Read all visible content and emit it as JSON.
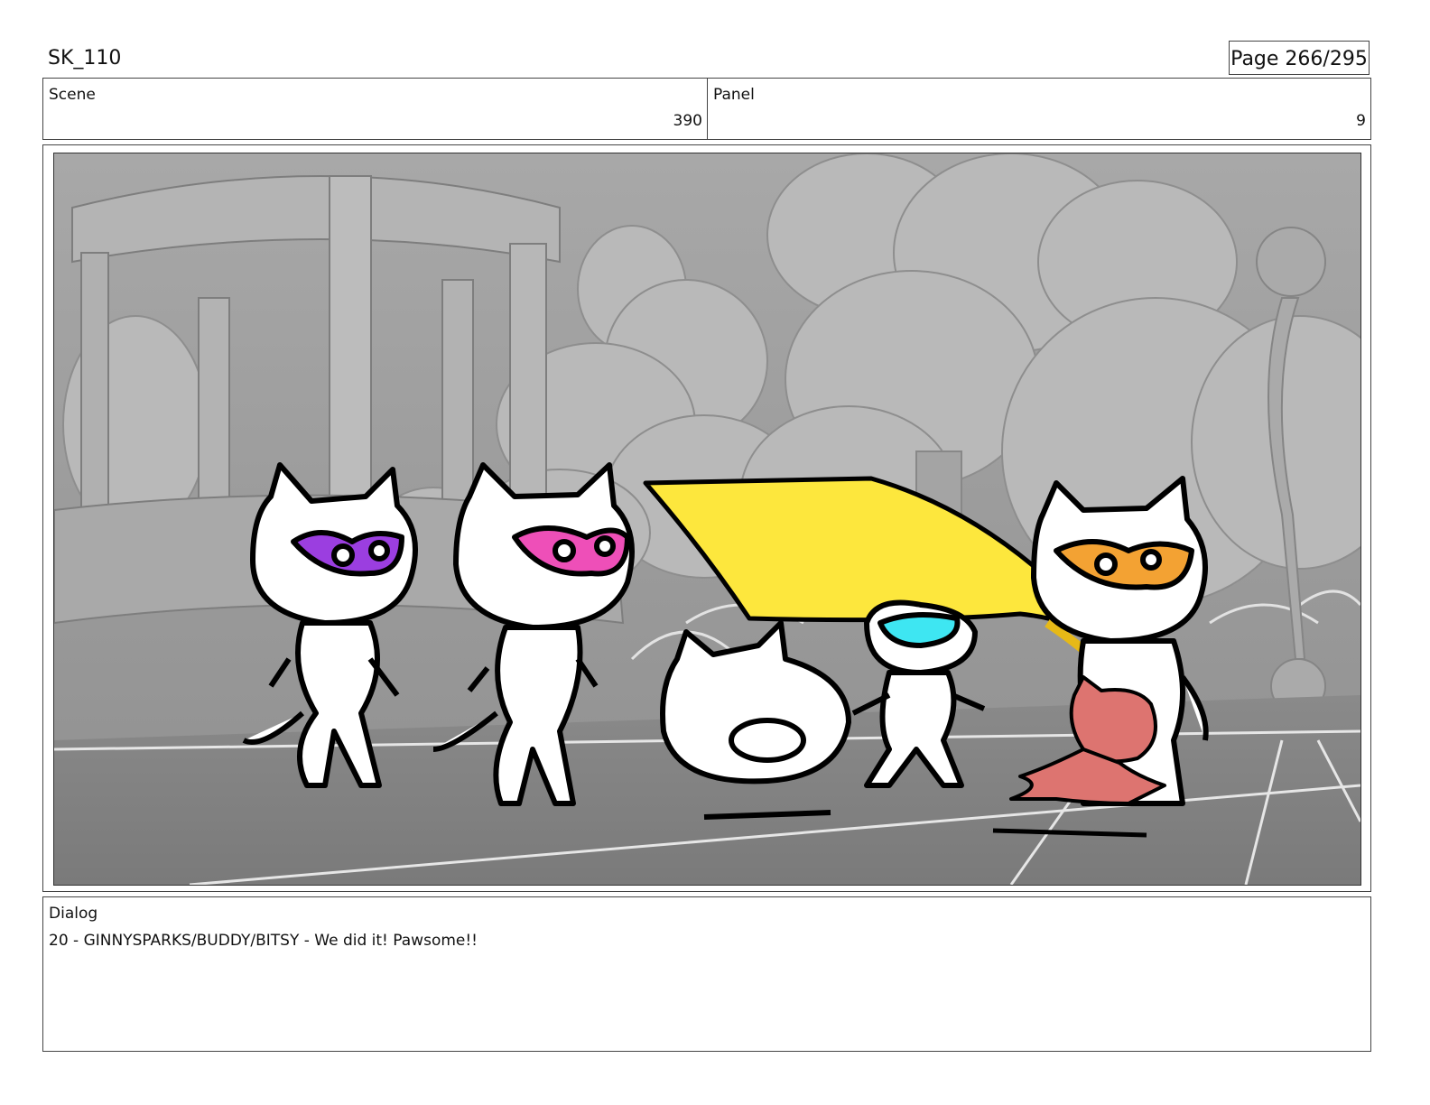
{
  "header": {
    "project": "SK_110",
    "page_label": "Page 266/295"
  },
  "info": {
    "scene_label": "Scene",
    "scene_value": "390",
    "panel_label": "Panel",
    "panel_value": "9"
  },
  "dialog": {
    "label": "Dialog",
    "text": "20 - GINNYSPARKS/BUDDY/BITSY - We did it! Pawsome!!"
  },
  "artwork": {
    "characters": [
      {
        "name": "purple-masked-cat",
        "accent": "#9b3ee0"
      },
      {
        "name": "pink-masked-cat",
        "accent": "#ee4fb8"
      },
      {
        "name": "fallen-cat",
        "accent": "#ffffff"
      },
      {
        "name": "cyan-masked-cat",
        "accent": "#3ee6f2"
      },
      {
        "name": "orange-masked-cat",
        "accent": "#f3a233"
      },
      {
        "name": "red-small-cat",
        "accent": "#dd7470"
      }
    ],
    "cape_color": "#fde73d",
    "background_tone": "#9a9a9a"
  }
}
